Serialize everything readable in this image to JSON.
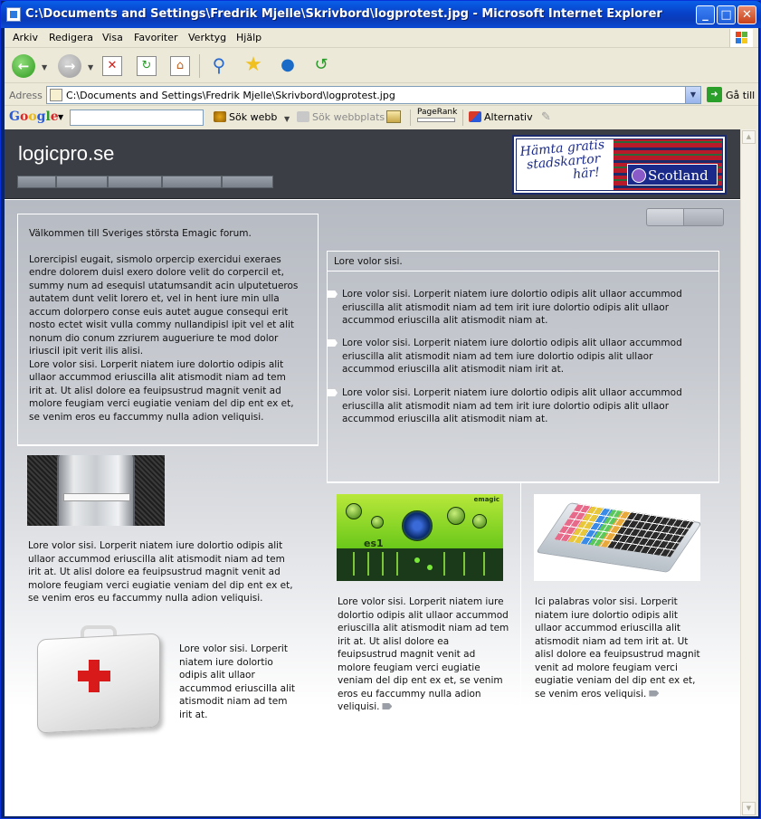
{
  "window": {
    "title": "C:\\Documents and Settings\\Fredrik Mjelle\\Skrivbord\\logprotest.jpg - Microsoft Internet Explorer",
    "minimize": "_",
    "maximize": "□",
    "close": "✕"
  },
  "menu": [
    "Arkiv",
    "Redigera",
    "Visa",
    "Favoriter",
    "Verktyg",
    "Hjälp"
  ],
  "address": {
    "label": "Adress",
    "url": "C:\\Documents and Settings\\Fredrik Mjelle\\Skrivbord\\logprotest.jpg",
    "go_label": "Gå till"
  },
  "googlebar": {
    "logo": [
      "G",
      "o",
      "o",
      "g",
      "l",
      "e"
    ],
    "search_value": "",
    "search_web": "Sök webb",
    "search_site": "Sök webbplats",
    "pagerank": "PageRank",
    "options": "Alternativ"
  },
  "site": {
    "logo": "logicpro.se",
    "ad": {
      "line1": "Hämta gratis",
      "line2": "stadskartor",
      "line3": "här!",
      "brand": "Scotland"
    },
    "intro": {
      "welcome": "Välkommen till Sveriges största Emagic forum.",
      "para1": "Lorercipisl eugait, sismolo orpercip exercidui exeraes endre dolorem duisl exero dolore velit do corpercil et, summy num ad esequisl utatumsandit acin ulputetueros autatem dunt velit lorero et, vel in hent iure min ulla accum dolorpero conse euis autet augue consequi erit nosto ectet wisit vulla commy nullandipisl ipit vel et alit nonum dio conum zzriurem augueriure te mod dolor iriuscil ipit verit ilis alisi.",
      "para2": "Lore volor sisi. Lorperit niatem iure dolortio odipis alit ullaor accummod eriuscilla alit atismodit niam ad tem irit at. Ut alisl dolore ea feuipsustrud magnit venit ad molore feugiam verci eugiatie veniam del dip ent ex et, se venim eros eu faccummy nulla adion veliquisi."
    },
    "macpro_caption": "Lore volor sisi. Lorperit niatem iure dolortio odipis alit ullaor accummod eriuscilla alit atismodit niam ad tem irit at. Ut alisl dolore ea feuipsustrud magnit venit ad molore feugiam verci eugiatie veniam del dip ent ex et, se venim eros eu faccummy nulla adion veliquisi.",
    "firstaid_caption": "Lore volor sisi. Lorperit niatem iure dolortio odipis alit ullaor accummod eriuscilla alit atismodit niam ad tem irit at.",
    "right_heading": "Lore volor sisi.",
    "bullets": [
      "Lore volor sisi. Lorperit niatem iure dolortio odipis alit ullaor accummod eriuscilla alit atismodit niam ad tem irit iure dolortio odipis alit ullaor accummod eriuscilla alit atismodit niam at.",
      "Lore volor sisi. Lorperit niatem iure dolortio odipis alit ullaor accummod eriuscilla alit atismodit niam ad tem iure dolortio odipis alit ullaor accummod eriuscilla alit atismodit niam irit at.",
      "Lore volor sisi. Lorperit niatem iure dolortio odipis alit ullaor accummod eriuscilla alit atismodit niam ad tem irit  iure dolortio odipis alit ullaor accummod eriuscilla alit atismodit niam at."
    ],
    "synth": {
      "label": "es1",
      "brand": "emagic"
    },
    "synth_caption": "Lore volor sisi. Lorperit niatem iure dolortio odipis alit ullaor accummod eriuscilla alit atismodit niam ad tem irit at. Ut alisl dolore ea feuipsustrud magnit venit ad molore feugiam verci eugiatie veniam del dip ent ex et, se venim eros eu faccummy nulla adion veliquisi.",
    "keyboard_caption": "Ici palabras volor sisi. Lorperit niatem iure dolortio odipis alit ullaor accummod eriuscilla alit atismodit niam ad tem irit at. Ut alisl dolore ea feuipsustrud magnit venit ad molore feugiam verci eugiatie veniam del dip ent ex et, se venim eros veliquisi."
  },
  "icons": {
    "back": "back-arrow-icon",
    "forward": "forward-arrow-icon",
    "stop": "stop-icon",
    "refresh": "refresh-icon",
    "home": "home-icon",
    "search": "search-icon",
    "favorites": "favorites-star-icon",
    "media": "media-icon",
    "history": "history-icon"
  },
  "colors": {
    "titlebar": "#0a3bb8",
    "site_header": "#3b3e44",
    "body_gradient_top": "#b6bac2"
  }
}
